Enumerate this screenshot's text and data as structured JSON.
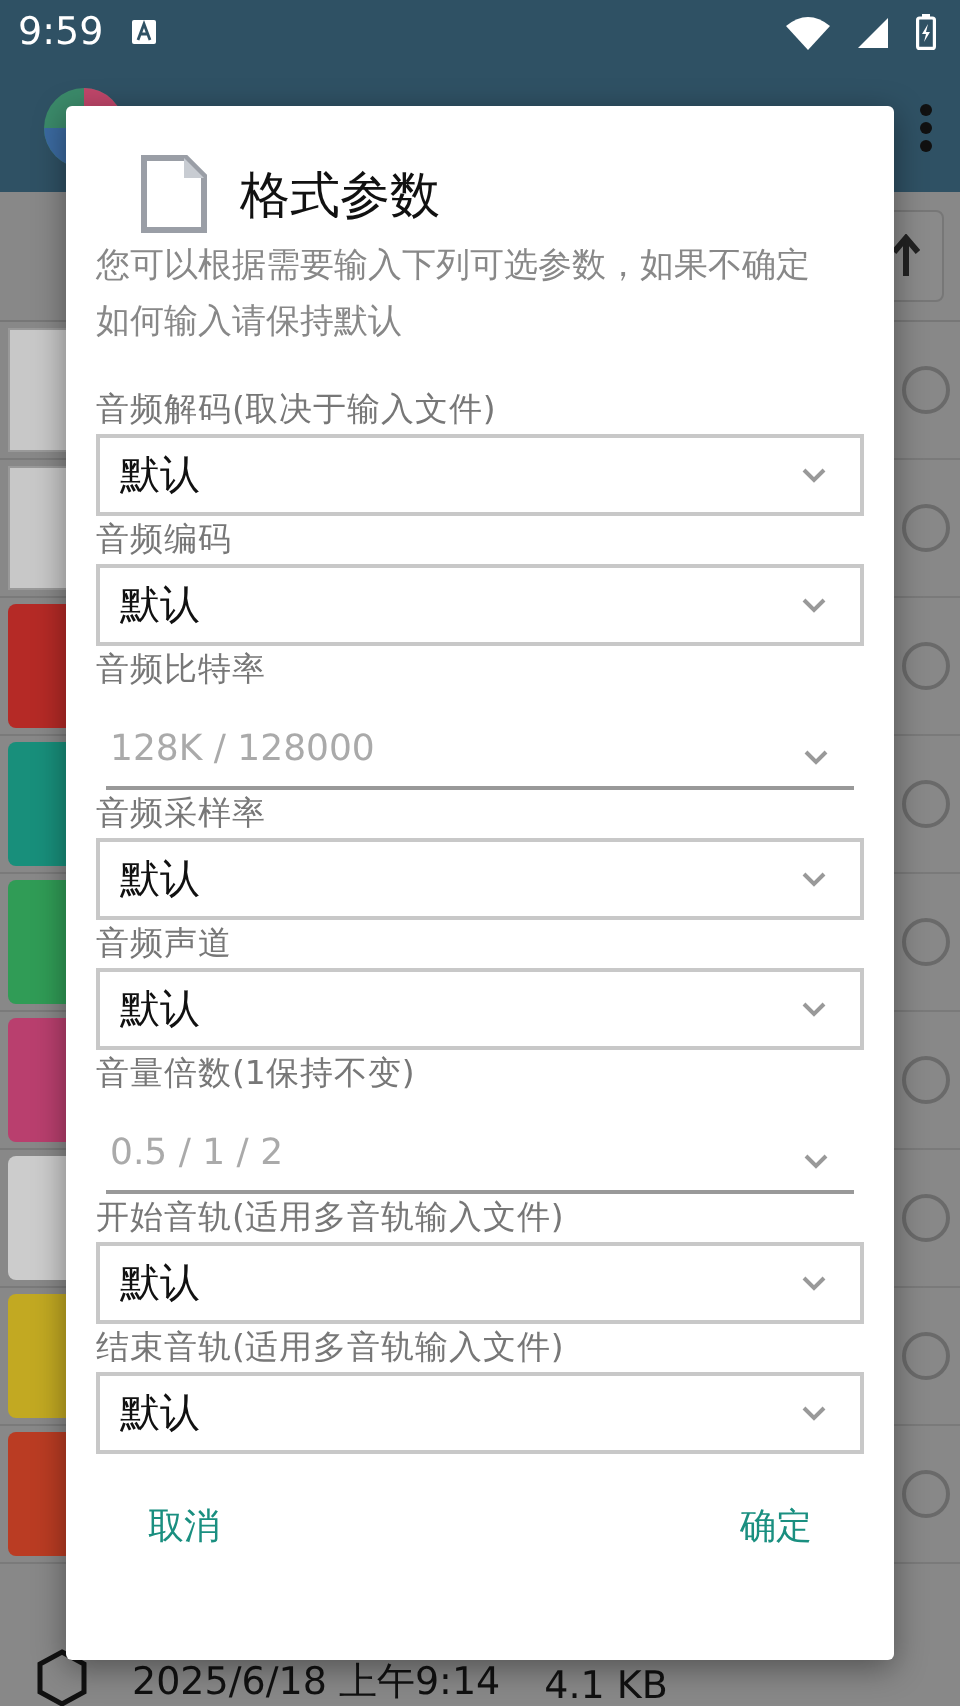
{
  "status_bar": {
    "time": "9:59"
  },
  "background": {
    "items": [
      {
        "kind": "thumbnail",
        "color": "#c8c8c8",
        "selected": false
      },
      {
        "kind": "thumbnail",
        "color": "#c8c8c8",
        "selected": false
      },
      {
        "kind": "app",
        "color": "#b52a26",
        "selected": false
      },
      {
        "kind": "app",
        "color": "#188f7b",
        "selected": false
      },
      {
        "kind": "app",
        "color": "#309c56",
        "selected": false
      },
      {
        "kind": "app",
        "color": "#b93f6e",
        "selected": false
      },
      {
        "kind": "app",
        "color": "#cccccc",
        "selected": false
      },
      {
        "kind": "app",
        "color": "#c2a922",
        "selected": false
      },
      {
        "kind": "app",
        "color": "#ba3c23",
        "selected": false
      }
    ],
    "last_item": {
      "date": "2025/6/18 上午9:14",
      "size": "4.1 KB"
    }
  },
  "dialog": {
    "title": "格式参数",
    "description": "您可以根据需要输入下列可选参数，如果不确定如何输入请保持默认",
    "fields": [
      {
        "label": "音频解码(取决于输入文件)",
        "kind": "select",
        "value": "默认"
      },
      {
        "label": "音频编码",
        "kind": "select",
        "value": "默认"
      },
      {
        "label": "音频比特率",
        "kind": "text",
        "placeholder": "128K / 128000"
      },
      {
        "label": "音频采样率",
        "kind": "select",
        "value": "默认"
      },
      {
        "label": "音频声道",
        "kind": "select",
        "value": "默认"
      },
      {
        "label": "音量倍数(1保持不变)",
        "kind": "text",
        "placeholder": "0.5 / 1 / 2"
      },
      {
        "label": "开始音轨(适用多音轨输入文件)",
        "kind": "select",
        "value": "默认"
      },
      {
        "label": "结束音轨(适用多音轨输入文件)",
        "kind": "select",
        "value": "默认"
      }
    ],
    "buttons": [
      "取消",
      "确定"
    ]
  }
}
